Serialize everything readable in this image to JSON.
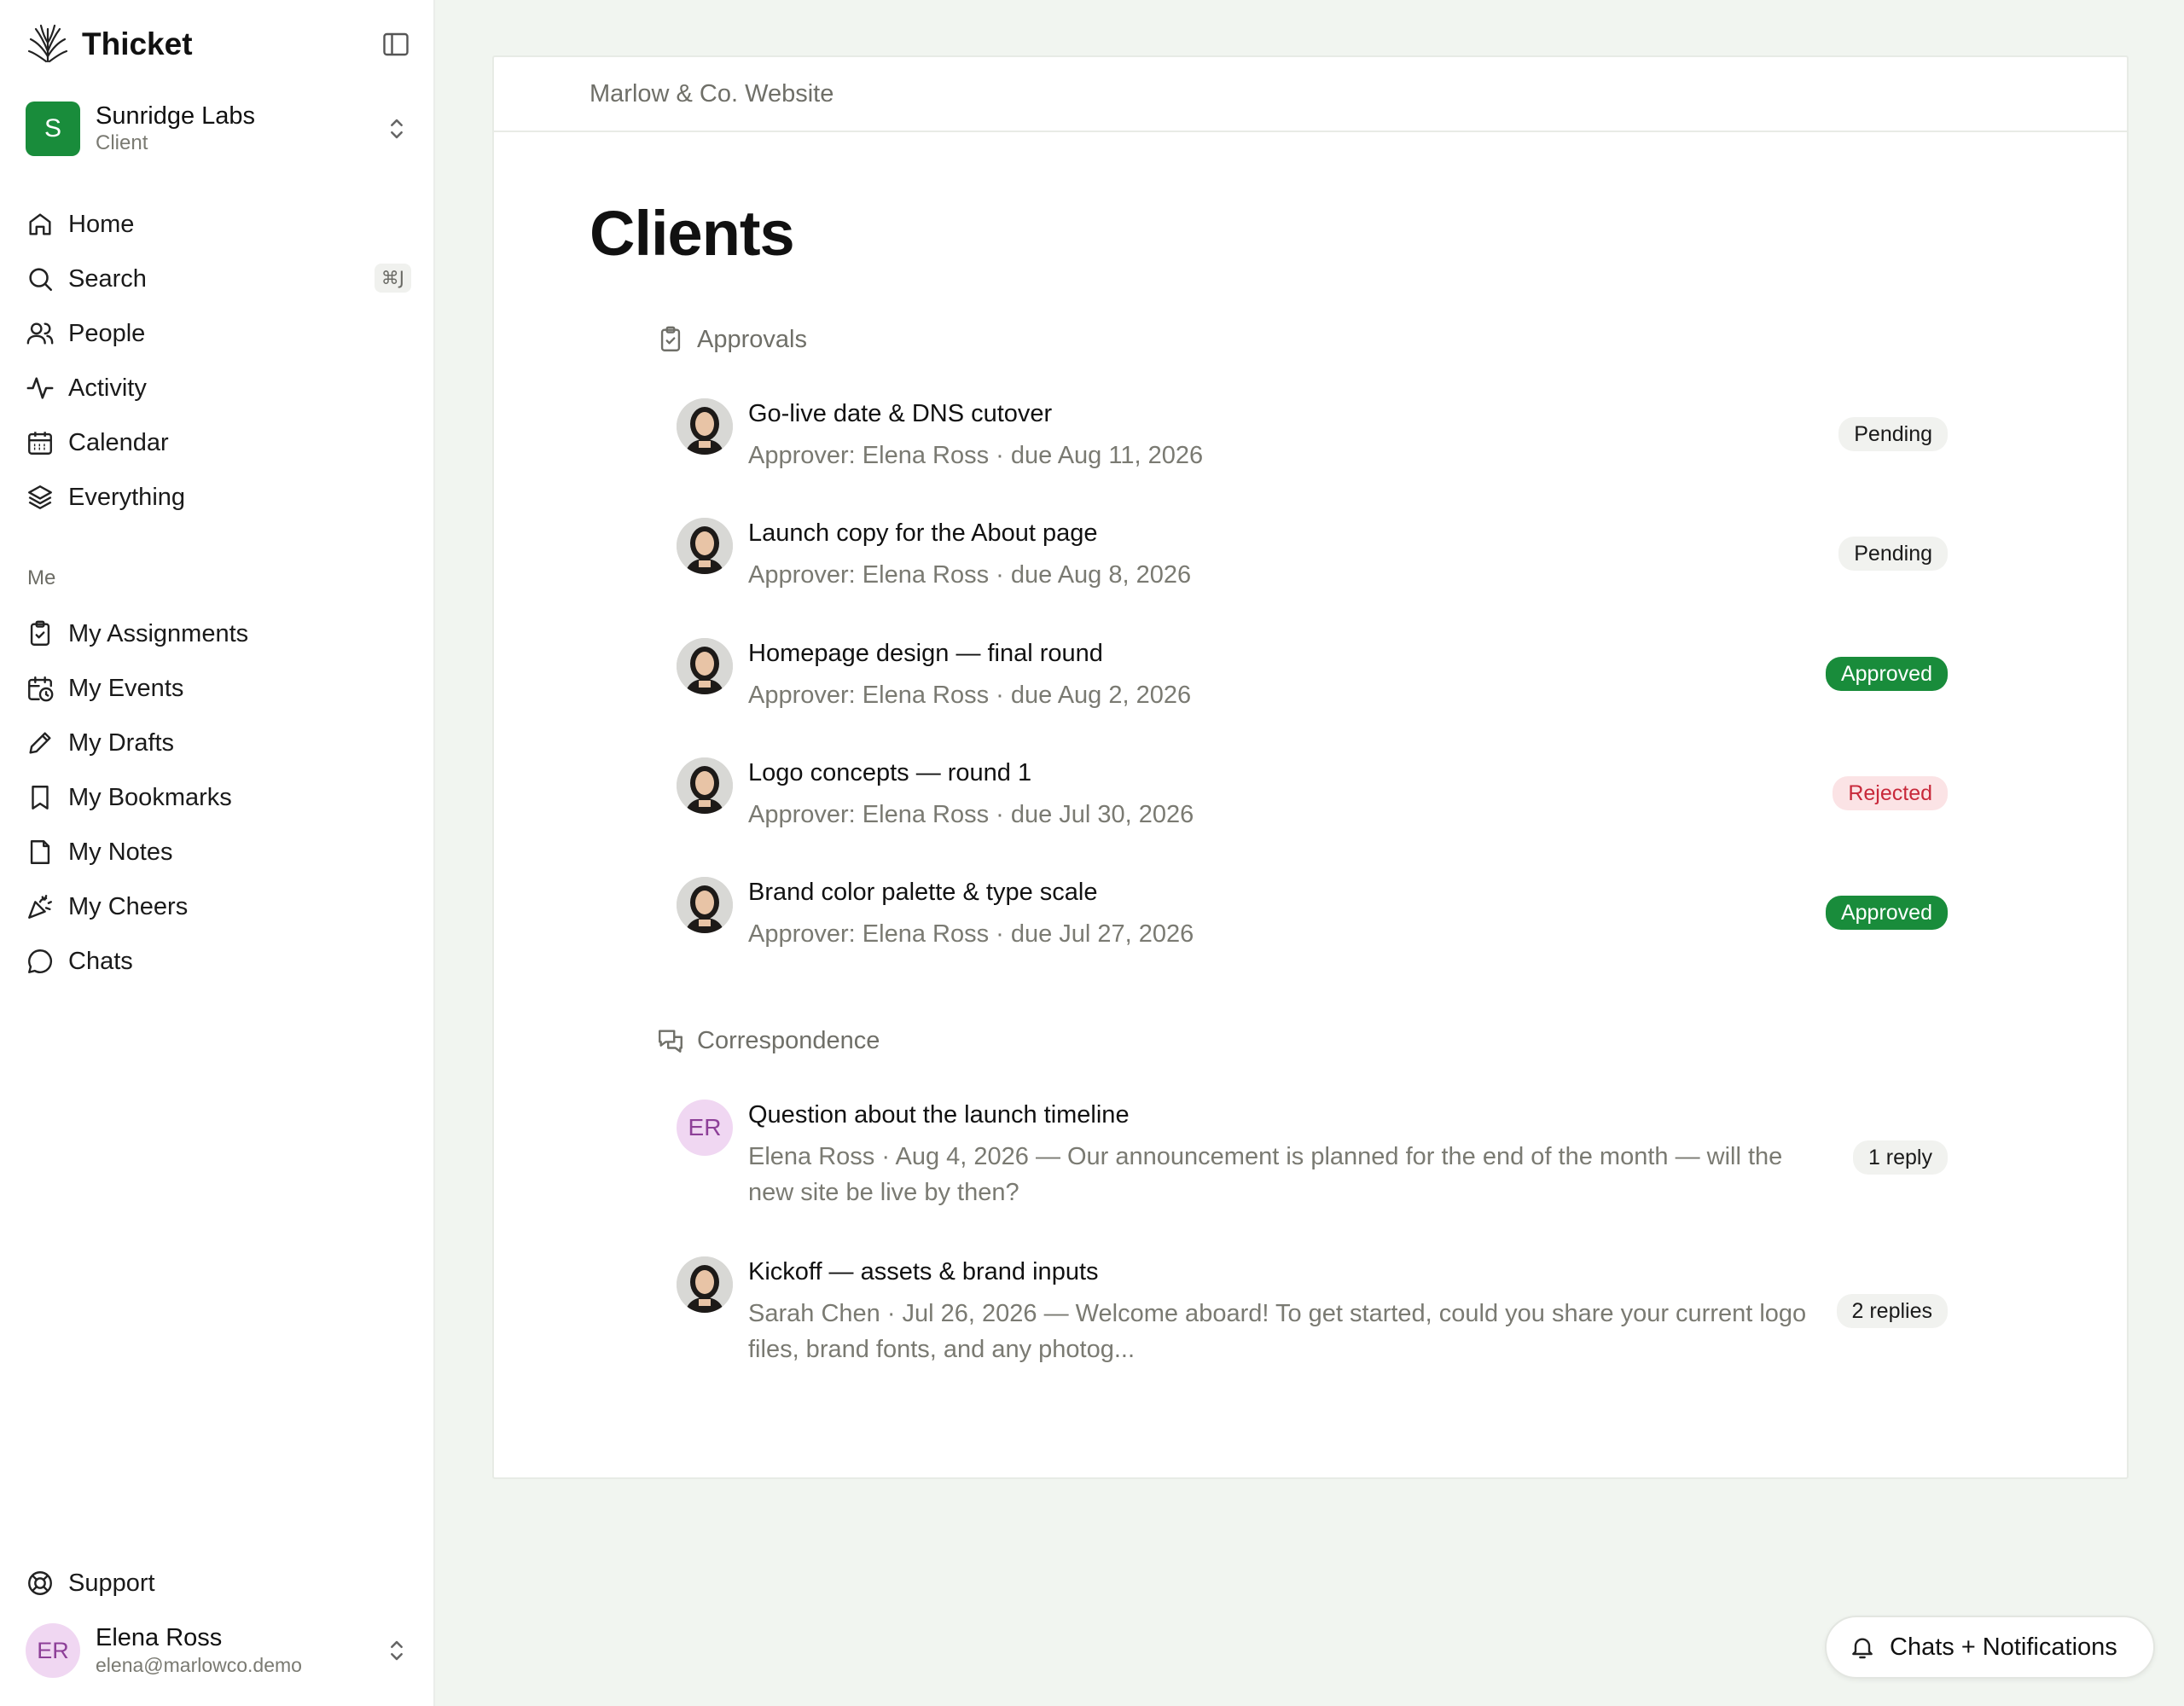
{
  "app": {
    "name": "Thicket"
  },
  "workspace": {
    "name": "Sunridge Labs",
    "role": "Client",
    "initial": "S"
  },
  "nav": {
    "home": "Home",
    "search": "Search",
    "search_shortcut": "⌘J",
    "people": "People",
    "activity": "Activity",
    "calendar": "Calendar",
    "everything": "Everything"
  },
  "me": {
    "label": "Me",
    "assignments": "My Assignments",
    "events": "My Events",
    "drafts": "My Drafts",
    "bookmarks": "My Bookmarks",
    "notes": "My Notes",
    "cheers": "My Cheers",
    "chats": "Chats"
  },
  "footer": {
    "support": "Support",
    "user_initials": "ER",
    "user_name": "Elena Ross",
    "user_email": "elena@marlowco.demo"
  },
  "breadcrumb": "Marlow & Co. Website",
  "page_title": "Clients",
  "approvals": {
    "heading": "Approvals",
    "items": [
      {
        "title": "Go-live date & DNS cutover",
        "sub": "Approver: Elena Ross · due Aug 11, 2026",
        "status": "Pending"
      },
      {
        "title": "Launch copy for the About page",
        "sub": "Approver: Elena Ross · due Aug 8, 2026",
        "status": "Pending"
      },
      {
        "title": "Homepage design — final round",
        "sub": "Approver: Elena Ross · due Aug 2, 2026",
        "status": "Approved"
      },
      {
        "title": "Logo concepts — round 1",
        "sub": "Approver: Elena Ross · due Jul 30, 2026",
        "status": "Rejected"
      },
      {
        "title": "Brand color palette & type scale",
        "sub": "Approver: Elena Ross · due Jul 27, 2026",
        "status": "Approved"
      }
    ]
  },
  "correspondence": {
    "heading": "Correspondence",
    "items": [
      {
        "initials": "ER",
        "title": "Question about the launch timeline",
        "sub": "Elena Ross · Aug 4, 2026 — Our announcement is planned for the end of the month — will the new site be live by then?",
        "replies": "1 reply"
      },
      {
        "title": "Kickoff — assets & brand inputs",
        "sub": "Sarah Chen · Jul 26, 2026 — Welcome aboard! To get started, could you share your current logo files, brand fonts, and any photog...",
        "replies": "2 replies"
      }
    ]
  },
  "notifications_button": "Chats + Notifications",
  "colors": {
    "accent": "#198c3b",
    "rejected": "#c8283a",
    "muted": "#7a7a72"
  }
}
